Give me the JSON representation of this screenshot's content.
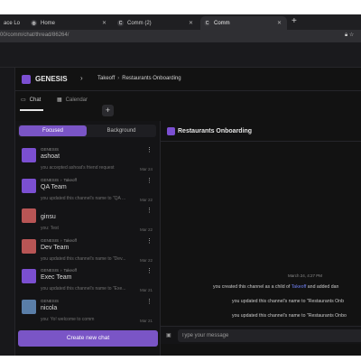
{
  "browser": {
    "tabs": [
      {
        "title": "ace Lo",
        "favicon": ""
      },
      {
        "title": "Home",
        "favicon": "globe-icon"
      },
      {
        "title": "Comm (2)",
        "favicon": "C"
      },
      {
        "title": "Comm",
        "favicon": "C"
      }
    ],
    "url": "00/comm/chat/thread/86264/"
  },
  "community": {
    "name": "GENESIS",
    "breadcrumb": [
      "Takeoff",
      "Restaurants Onboarding"
    ]
  },
  "views": {
    "chat": "Chat",
    "calendar": "Calendar",
    "plus": "+"
  },
  "segment": {
    "focused": "Focused",
    "background": "Background"
  },
  "threads": [
    {
      "community": "GENESIS",
      "parent": "",
      "name": "ashoat",
      "last": "you accepted ashoat's friend request",
      "date": "Mar 24",
      "color": "#7b4fd1"
    },
    {
      "community": "GENESIS",
      "parent": "Takeoff",
      "name": "QA Team",
      "last": "you updated this channel's name to \"QA ...",
      "date": "Mar 22",
      "color": "#7b4fd1"
    },
    {
      "community": "",
      "parent": "",
      "name": "ginsu",
      "last": "you: Test",
      "date": "Mar 22",
      "color": "#b85555"
    },
    {
      "community": "GENESIS",
      "parent": "Takeoff",
      "name": "Dev Team",
      "last": "you updated this channel's name to \"Dev...",
      "date": "Mar 22",
      "color": "#b85555"
    },
    {
      "community": "GENESIS",
      "parent": "Takeoff",
      "name": "Exec Team",
      "last": "you updated this channel's name to \"Exe...",
      "date": "Mar 21",
      "color": "#7b4fd1"
    },
    {
      "community": "GENESIS",
      "parent": "",
      "name": "nicola",
      "last": "you: Yo! welcome to comm",
      "date": "Mar 21",
      "color": "#5a7ea8"
    },
    {
      "community": "GENESIS",
      "parent": "Takeoff",
      "name": "",
      "last": "",
      "date": "",
      "color": "#7b4fd1"
    }
  ],
  "new_chat_label": "Create new chat",
  "chat": {
    "title": "Restaurants Onboarding",
    "timestamp": "March 24, 4:27 PM",
    "messages": [
      {
        "pre": "you created this channel as a child of ",
        "link": "Takeoff",
        "post": " and added dan"
      },
      {
        "pre": "you updated this channel's name to \"Restaurants Onb",
        "link": "",
        "post": ""
      },
      {
        "pre": "you updated this channel's name to \"Restaurants Onbo",
        "link": "",
        "post": ""
      }
    ],
    "composer_placeholder": "Type your message"
  }
}
